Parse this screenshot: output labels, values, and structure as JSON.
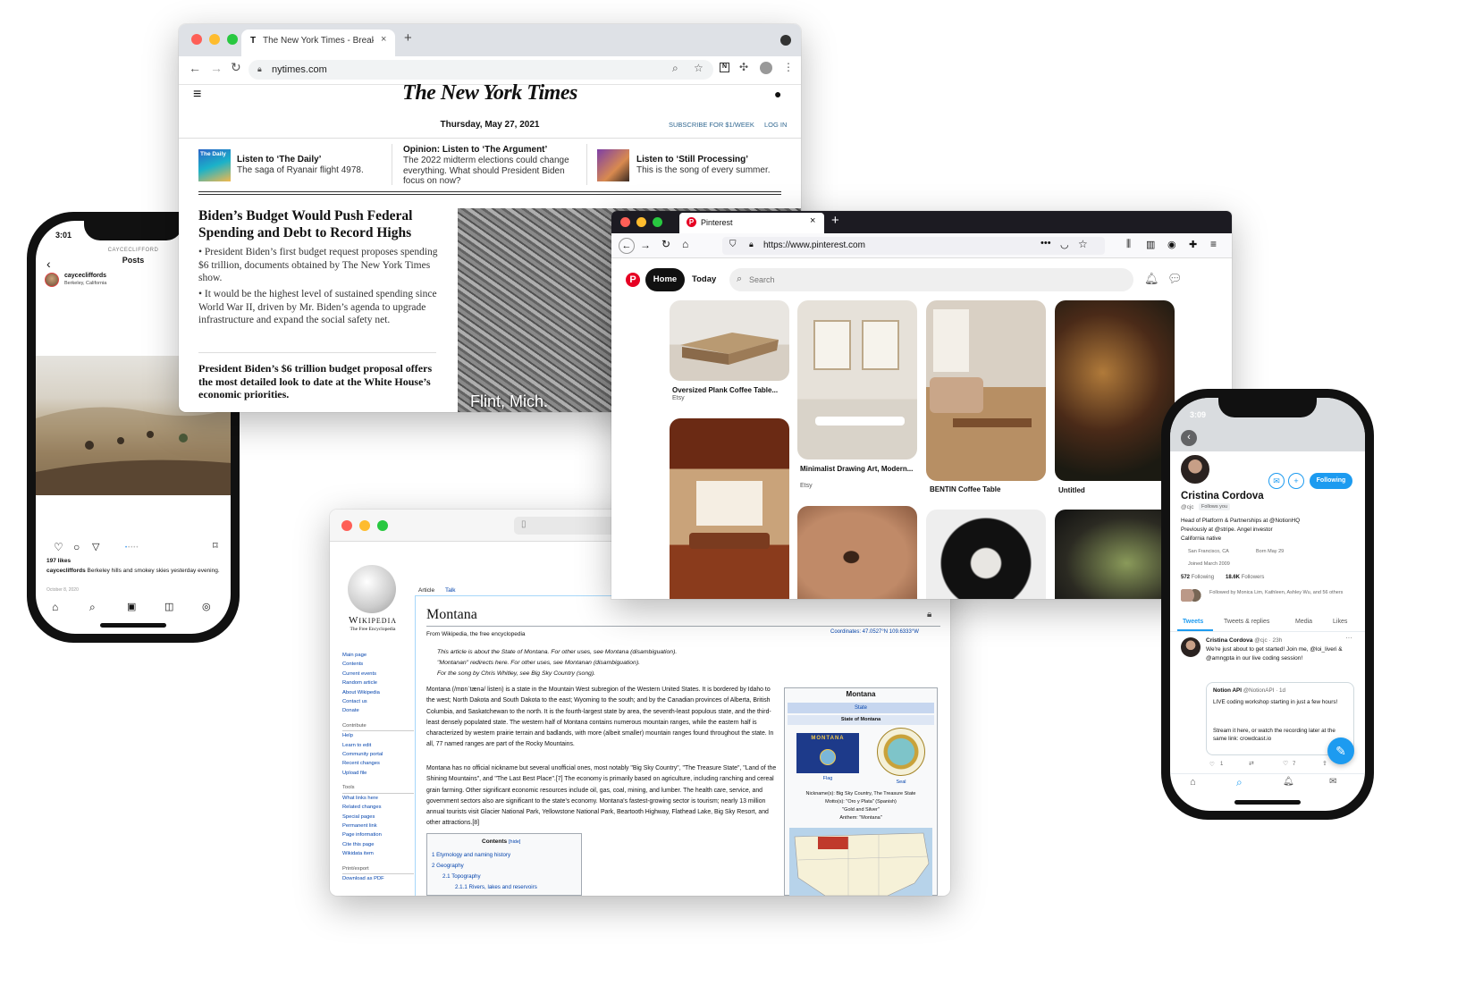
{
  "nyt": {
    "tab_title": "The New York Times - Breaking",
    "url": "nytimes.com",
    "masthead": "The New York Times",
    "date": "Thursday, May 27, 2021",
    "subscribe": "SUBSCRIBE FOR $1/WEEK",
    "login": "LOG IN",
    "promos": [
      {
        "title": "Listen to ‘The Daily’",
        "sub": "The saga of Ryanair flight 4978.",
        "thumb": "The Daily"
      },
      {
        "title": "Opinion: Listen to ‘The Argument’",
        "sub": "The 2022 midterm elections could change everything. What should President Biden focus on now?"
      },
      {
        "title": "Listen to ‘Still Processing’",
        "sub": "This is the song of every summer."
      }
    ],
    "headline": "Biden’s Budget Would Push Federal Spending and Debt to Record Highs",
    "bullets": [
      "President Biden’s first budget request proposes spending $6 trillion, documents obtained by The New York Times show.",
      "It would be the highest level of sustained spending since World War II, driven by Mr. Biden’s agenda to upgrade infrastructure and expand the social safety net."
    ],
    "second": "President Biden’s $6 trillion budget proposal offers the most detailed look to date at the White House’s economic priorities.",
    "photo_caption": "Flint, Mich."
  },
  "pin": {
    "tab_title": "Pinterest",
    "url": "https://www.pinterest.com",
    "home": "Home",
    "today": "Today",
    "search": "Search",
    "pins": [
      {
        "title": "Oversized Plank Coffee Table...",
        "source": "Etsy"
      },
      {
        "title": "Minimalist Drawing Art, Modern...",
        "source": "Etsy"
      },
      {
        "title": "BENTIN Coffee Table",
        "source": ""
      },
      {
        "title": "Untitled",
        "source": ""
      }
    ]
  },
  "wiki": {
    "logo": "Wikipedia",
    "tagline": "The Free Encyclopedia",
    "tabs": [
      "Article",
      "Talk"
    ],
    "title": "Montana",
    "from": "From Wikipedia, the free encyclopedia",
    "coords": "Coordinates: 47.0527°N 109.6333°W",
    "hatnotes": [
      "This article is about the State of Montana. For other uses, see Montana (disambiguation).",
      "\"Montanan\" redirects here. For other uses, see Montanan (disambiguation).",
      "For the song by Chris Whitley, see Big Sky Country (song)."
    ],
    "para1": "Montana (/mɒnˈtænə/ listen) is a state in the Mountain West subregion of the Western United States. It is bordered by Idaho to the west; North Dakota and South Dakota to the east; Wyoming to the south; and by the Canadian provinces of Alberta, British Columbia, and Saskatchewan to the north. It is the fourth-largest state by area, the seventh-least populous state, and the third-least densely populated state. The western half of Montana contains numerous mountain ranges, while the eastern half is characterized by western prairie terrain and badlands, with more (albeit smaller) mountain ranges found throughout the state. In all, 77 named ranges are part of the Rocky Mountains.",
    "para2": "Montana has no official nickname but several unofficial ones, most notably \"Big Sky Country\", \"The Treasure State\", \"Land of the Shining Mountains\", and \"The Last Best Place\".[7] The economy is primarily based on agriculture, including ranching and cereal grain farming. Other significant economic resources include oil, gas, coal, mining, and lumber. The health care, service, and government sectors also are significant to the state's economy. Montana's fastest-growing sector is tourism; nearly 13 million annual tourists visit Glacier National Park, Yellowstone National Park, Beartooth Highway, Flathead Lake, Big Sky Resort, and other attractions.[8]",
    "nav_main": [
      "Main page",
      "Contents",
      "Current events",
      "Random article",
      "About Wikipedia",
      "Contact us",
      "Donate"
    ],
    "nav_contribute_head": "Contribute",
    "nav_contribute": [
      "Help",
      "Learn to edit",
      "Community portal",
      "Recent changes",
      "Upload file"
    ],
    "nav_tools_head": "Tools",
    "nav_tools": [
      "What links here",
      "Related changes",
      "Special pages",
      "Permanent link",
      "Page information",
      "Cite this page",
      "Wikidata item"
    ],
    "nav_print_head": "Print/export",
    "nav_print": [
      "Download as PDF"
    ],
    "infobox_title": "Montana",
    "infobox_state": "State",
    "infobox_sub": "State of Montana",
    "flag_text": "MONTANA",
    "flag": "Flag",
    "seal": "Seal",
    "nickname": "Nickname(s): Big Sky Country, The Treasure State",
    "motto": "Motto(s): \"Oro y Plata\" (Spanish)",
    "motto2": "\"Gold and Silver\"",
    "anthem": "Anthem: \"Montana\"",
    "contents_title": "Contents",
    "contents_hide": "[hide]",
    "contents": [
      "1  Etymology and naming history",
      "2  Geography",
      "2.1  Topography",
      "2.1.1  Rivers, lakes and reservoirs"
    ]
  },
  "ig": {
    "time": "3:01",
    "account_caps": "CAYCECLIFFORD",
    "header": "Posts",
    "username": "caycecliffords",
    "location": "Berkeley, California",
    "likes": "197 likes",
    "caption_user": "caycecliffords",
    "caption": "Berkeley hills and smokey skies yesterday evening.",
    "date": "October 8, 2020"
  },
  "tw": {
    "time": "3:09",
    "following": "Following",
    "name": "Cristina Cordova",
    "handle": "@cjc",
    "follows_you": "Follows you",
    "bio1": "Head of Platform & Partnerships at @NotionHQ",
    "bio2": "Previously at @stripe. Angel investor",
    "bio3": "California native",
    "location": "San Francisco, CA",
    "born": "Born May 29",
    "joined": "Joined March 2009",
    "following_count": "572",
    "following_label": "Following",
    "followers_count": "18.6K",
    "followers_label": "Followers",
    "followed_by": "Followed by Monica Lim, Kathleen, Ashley Wu, and 56 others",
    "tabs": [
      "Tweets",
      "Tweets & replies",
      "Media",
      "Likes"
    ],
    "tweet_name": "Cristina Cordova",
    "tweet_meta": "@cjc · 23h",
    "tweet_text": "We're just about to get started! Join me, @loi_liveri & @amngpta in our live coding session!",
    "quote_name": "Notion API",
    "quote_meta": "@NotionAPI · 1d",
    "quote_text": "LIVE coding workshop starting in just a few hours!",
    "quote_text2": "Stream it here, or watch the recording later at the same link: crowdcast.io",
    "reply_count": "1",
    "like_count": "7"
  }
}
